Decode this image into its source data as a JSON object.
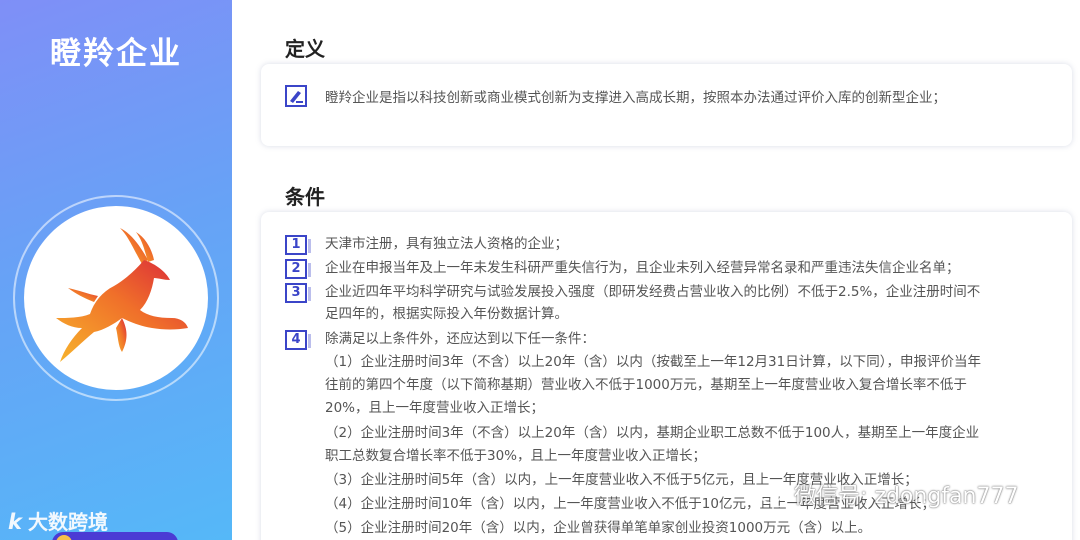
{
  "sidebar": {
    "title": "瞪羚企业",
    "source_mark": "大数跨境",
    "source_logo": "k"
  },
  "definition": {
    "heading": "定义",
    "icon": "document-edit-icon",
    "text": "瞪羚企业是指以科技创新或商业模式创新为支撑进入高成长期，按照本办法通过评价入库的创新型企业；"
  },
  "conditions": {
    "heading": "条件",
    "items": [
      {
        "num": "1",
        "lines": [
          "天津市注册，具有独立法人资格的企业；"
        ]
      },
      {
        "num": "2",
        "lines": [
          "企业在申报当年及上一年未发生科研严重失信行为，且企业未列入经营异常名录和严重违法失信企业名单；"
        ]
      },
      {
        "num": "3",
        "lines": [
          "企业近四年平均科学研究与试验发展投入强度（即研发经费占营业收入的比例）不低于2.5%，企业注册时间不",
          "足四年的，根据实际投入年份数据计算。"
        ]
      },
      {
        "num": "4",
        "lines": [
          "除满足以上条件外，还应达到以下任一条件："
        ]
      }
    ],
    "sub_items": [
      "（1）企业注册时间3年（不含）以上20年（含）以内（按截至上一年12月31日计算，以下同），申报评价当年",
      "往前的第四个年度（以下简称基期）营业收入不低于1000万元，基期至上一年度营业收入复合增长率不低于",
      "20%，且上一年度营业收入正增长；",
      "（2）企业注册时间3年（不含）以上20年（含）以内，基期企业职工总数不低于100人，基期至上一年度企业",
      "职工总数复合增长率不低于30%，且上一年度营业收入正增长；",
      "（3）企业注册时间5年（含）以内，上一年度营业收入不低于5亿元，且上一年度营业收入正增长；",
      "（4）企业注册时间10年（含）以内，上一年度营业收入不低于10亿元，且上一年度营业收入正增长；",
      "（5）企业注册时间20年（含）以内，企业曾获得单笔单家创业投资1000万元（含）以上。"
    ]
  },
  "watermark": {
    "text": "微信号: zdongfan777",
    "icon": "wechat-icon"
  },
  "colors": {
    "accent": "#3b45c8",
    "sidebar_top": "#7f8ff7",
    "sidebar_bottom": "#55b8f8"
  }
}
